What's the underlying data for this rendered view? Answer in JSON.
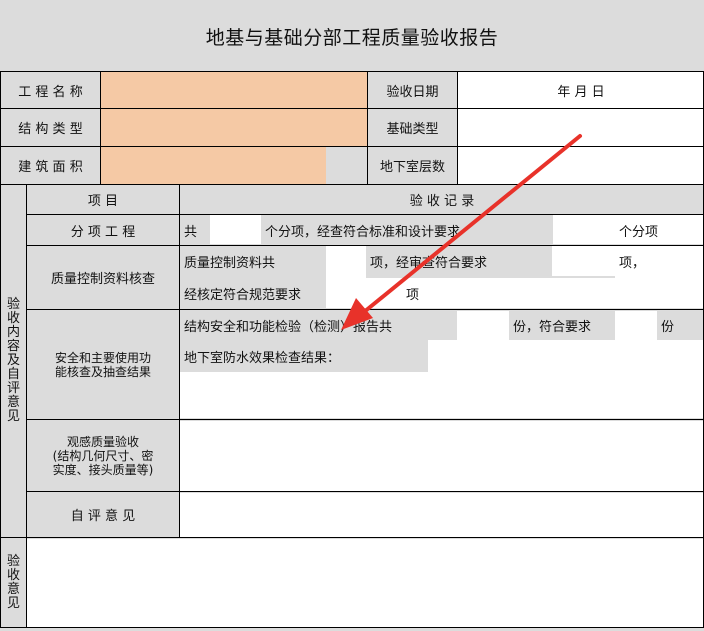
{
  "title": "地基与基础分部工程质量验收报告",
  "header_rows": {
    "project_name_label": "工 程 名 称",
    "acceptance_date_label": "验收日期",
    "date_value": "年    月    日",
    "structure_type_label": "结 构 类 型",
    "foundation_type_label": "基础类型",
    "building_area_label": "建 筑 面 积",
    "basement_floors_label": "地下室层数"
  },
  "side_labels": {
    "acceptance_content": "验收内容及自评意见",
    "acceptance_opinion": "验收意见"
  },
  "table_header": {
    "item": "项      目",
    "record": "验      收      记      录"
  },
  "rows": {
    "subitem_label": "分  项  工  程",
    "subitem_prefix": "共",
    "subitem_middle": "个分项，经查符合标准和设计要求",
    "subitem_suffix": "个分项",
    "qc_label": "质量控制资料核查",
    "qc_line1_a": "质量控制资料共",
    "qc_line1_b": "项，经审查符合要求",
    "qc_line1_c": "项，",
    "qc_line2_a": "经核定符合规范要求",
    "qc_line2_b": "项",
    "safety_label_1": "安全和主要使用功",
    "safety_label_2": "能核查及抽查结果",
    "safety_line1_a": "结构安全和功能检验（检测）报告共",
    "safety_line1_b": "份，符合要求",
    "safety_line1_c": "份",
    "safety_line2": "地下室防水效果检查结果：",
    "visual_label_1": "观感质量验收",
    "visual_label_2": "(结构几何尺寸、密",
    "visual_label_3": "实度、接头质量等)",
    "self_eval_label": "自  评  意  见"
  },
  "colors": {
    "header_fill": "#dcdcdc",
    "input_fill": "#f5c9a5",
    "arrow": "#e8322a"
  }
}
